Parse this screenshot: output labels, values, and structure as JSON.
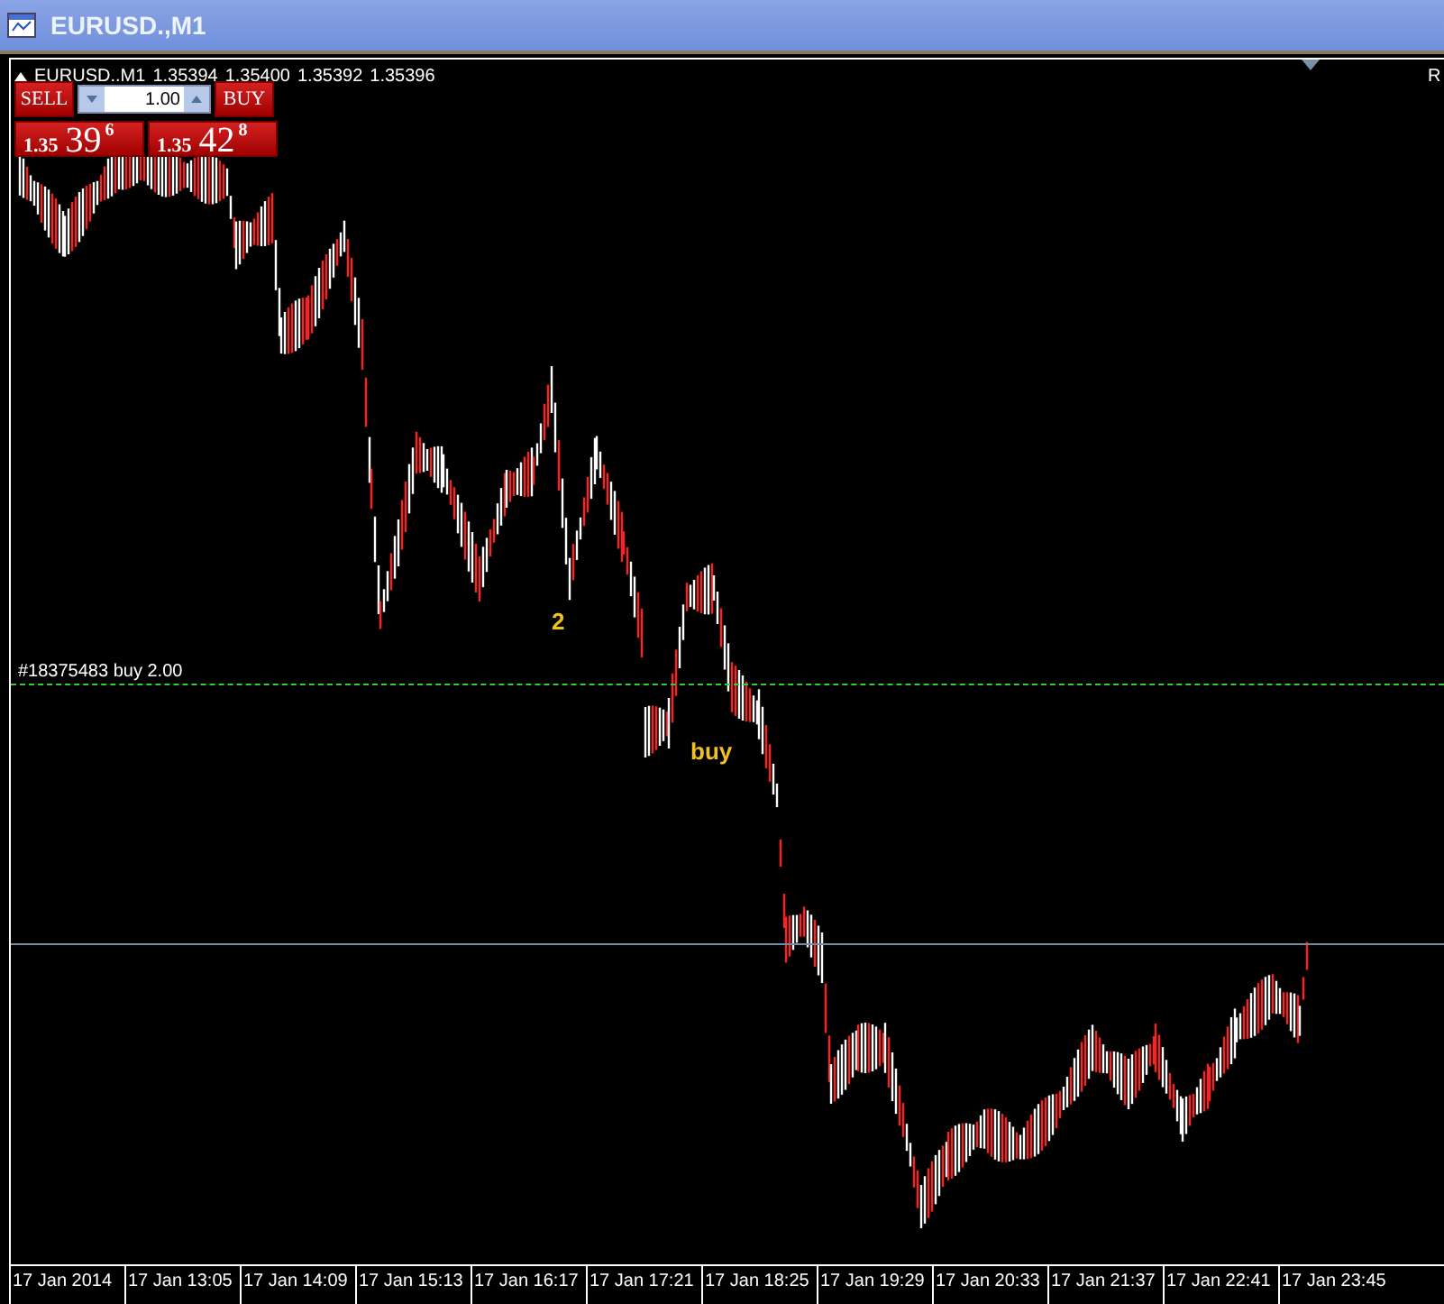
{
  "window": {
    "title": "EURUSD.,M1"
  },
  "chart": {
    "symbol": "EURUSD.,M1",
    "quotes": [
      "1.35394",
      "1.35400",
      "1.35392",
      "1.35396"
    ],
    "edge_label": "R",
    "one_click": {
      "sell_label": "SELL",
      "buy_label": "BUY",
      "lot": "1.00",
      "sell_price": {
        "prefix": "1.35",
        "big": "39",
        "point": "6"
      },
      "buy_price": {
        "prefix": "1.35",
        "big": "42",
        "point": "8"
      }
    },
    "order_line": {
      "label": "#18375483 buy 2.00"
    },
    "annotations": [
      {
        "text": "2"
      },
      {
        "text": "buy"
      }
    ]
  },
  "time_axis": [
    "17 Jan 2014",
    "17 Jan 13:05",
    "17 Jan 14:09",
    "17 Jan 15:13",
    "17 Jan 16:17",
    "17 Jan 17:21",
    "17 Jan 18:25",
    "17 Jan 19:29",
    "17 Jan 20:33",
    "17 Jan 21:37",
    "17 Jan 22:41",
    "17 Jan 23:45"
  ]
}
